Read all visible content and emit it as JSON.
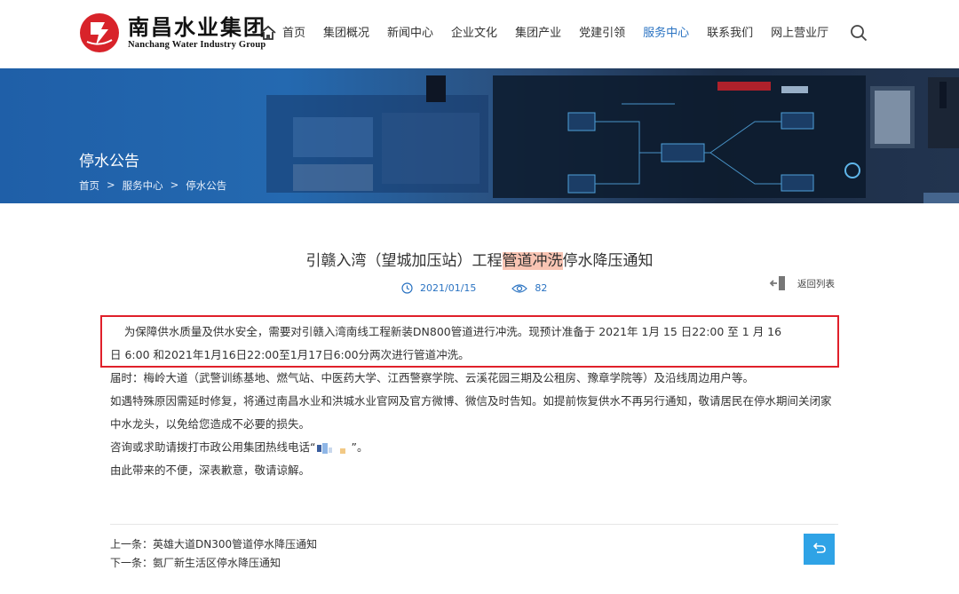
{
  "header": {
    "logo_cn": "南昌水业集团",
    "logo_en": "Nanchang Water Industry Group",
    "nav": [
      "首页",
      "集团概况",
      "新闻中心",
      "企业文化",
      "集团产业",
      "党建引领",
      "服务中心",
      "联系我们",
      "网上营业厅"
    ],
    "active_nav": "服务中心"
  },
  "banner": {
    "title": "停水公告",
    "breadcrumb": [
      "首页",
      ">",
      "服务中心",
      ">",
      "停水公告"
    ]
  },
  "article": {
    "title_pre": "引赣入湾（望城加压站）工程",
    "title_hl": "管道冲洗",
    "title_post": "停水降压通知",
    "date": "2021/01/15",
    "views": "82",
    "back_label": "返回列表",
    "p1_line1": "为保障供水质量及供水安全，需要对引赣入湾南线工程新装DN800管道进行冲洗。现预计准备于 2021年 1月 15 日22:00  至 1 月 16",
    "p1_line2": "日 6:00 和2021年1月16日22:00至1月17日6:00分两次进行管道冲洗。",
    "p2": "届时：梅岭大道（武警训练基地、燃气站、中医药大学、江西警察学院、云溪花园三期及公租房、豫章学院等）及沿线周边用户等。",
    "p3": "如遇特殊原因需延时修复，将通过南昌水业和洪城水业官网及官方微博、微信及时告知。如提前恢复供水不再另行通知，敬请居民在停水期间关闭家中水龙头，以免给您造成不必要的损失。",
    "p4_pre": "咨询或求助请拨打市政公用集团热线电话“",
    "p4_post": "”。",
    "p5": "由此带来的不便，深表歉意，敬请谅解。"
  },
  "footer": {
    "prev": "上一条：英雄大道DN300管道停水降压通知",
    "next": "下一条：氨厂新生活区停水降压通知"
  },
  "colors": {
    "accent": "#2a73c2",
    "highlight": "#f9c4b3",
    "annotation_box": "#e0202a",
    "back_top_button": "#2fa3e6"
  }
}
